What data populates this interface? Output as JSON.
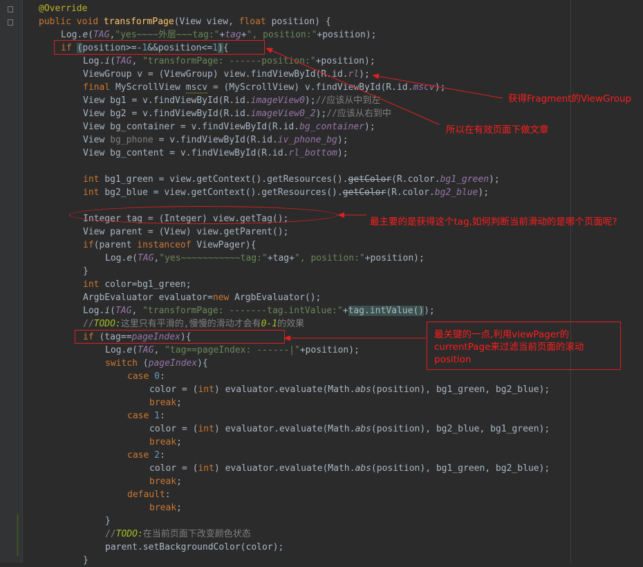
{
  "code_lines": [
    [
      [
        "@Override",
        "ann"
      ]
    ],
    [
      [
        "public void ",
        "kw"
      ],
      [
        "transformPage",
        "fn"
      ],
      [
        "(View view, "
      ],
      [
        "float ",
        "kw"
      ],
      [
        "position) {"
      ]
    ],
    [
      [
        "Log."
      ],
      [
        "e",
        "ital"
      ],
      [
        "("
      ],
      [
        "TAG",
        "fld"
      ],
      [
        ","
      ],
      [
        "\"yes~~~~外层~~~tag:\"",
        "str"
      ],
      [
        "+"
      ],
      [
        "tag",
        "fld"
      ],
      [
        "+"
      ],
      [
        "\", position:\"",
        "str"
      ],
      [
        "+position);"
      ]
    ],
    [
      [
        "if ",
        "kw"
      ],
      [
        "(",
        "hl"
      ],
      [
        "position>=-"
      ],
      [
        "1",
        "num"
      ],
      [
        "&&position<="
      ],
      [
        "1",
        "num"
      ],
      [
        ")",
        "hl"
      ],
      [
        "{"
      ]
    ],
    [
      [
        "Log."
      ],
      [
        "i",
        "ital"
      ],
      [
        "("
      ],
      [
        "TAG",
        "fld"
      ],
      [
        ", "
      ],
      [
        "\"transformPage: ------position:\"",
        "str"
      ],
      [
        "+position);"
      ]
    ],
    [
      [
        "ViewGroup v = (ViewGroup) view.findViewById(R.id."
      ],
      [
        "rl",
        "fld"
      ],
      [
        ");"
      ]
    ],
    [
      [
        "final ",
        "kw"
      ],
      [
        "MyScrollView "
      ],
      [
        "mscv",
        "warn"
      ],
      [
        " = (MyScrollView) v.findViewById(R.id."
      ],
      [
        "mscv",
        "fld"
      ],
      [
        ");"
      ]
    ],
    [
      [
        "View bg1 = v.findViewById(R.id."
      ],
      [
        "imageView0",
        "fld"
      ],
      [
        ");"
      ],
      [
        "//应该从中到左",
        "cmt"
      ]
    ],
    [
      [
        "View bg2 = v.findViewById(R.id."
      ],
      [
        "imageView0_2",
        "fld"
      ],
      [
        ");"
      ],
      [
        "//应该从右到中",
        "cmt"
      ]
    ],
    [
      [
        "View bg_container = v.findViewById(R.id."
      ],
      [
        "bg_container",
        "fld"
      ],
      [
        ");"
      ]
    ],
    [
      [
        "View "
      ],
      [
        "bg_phone",
        "cmt"
      ],
      [
        " = v.findViewById(R.id."
      ],
      [
        "iv_phone_bg",
        "fld"
      ],
      [
        ");"
      ]
    ],
    [
      [
        "View bg_content = v.findViewById(R.id."
      ],
      [
        "rl_bottom",
        "fld"
      ],
      [
        ");"
      ]
    ],
    [],
    [
      [
        "int ",
        "kw"
      ],
      [
        "bg1_green = view.getContext().getResources()."
      ],
      [
        "getColor",
        "strike"
      ],
      [
        "(R.color."
      ],
      [
        "bg1_green",
        "fld"
      ],
      [
        ");"
      ]
    ],
    [
      [
        "int ",
        "kw"
      ],
      [
        "bg2_blue = view.getContext().getResources()."
      ],
      [
        "getColor",
        "strike"
      ],
      [
        "(R.color."
      ],
      [
        "bg2_blue",
        "fld"
      ],
      [
        ");"
      ]
    ],
    [],
    [
      [
        "Integer tag = (Integer) view.getTag();"
      ]
    ],
    [
      [
        "View parent = (View) view.getParent();"
      ]
    ],
    [
      [
        "if",
        "kw"
      ],
      [
        "(parent "
      ],
      [
        "instanceof ",
        "kw"
      ],
      [
        "ViewPager){"
      ]
    ],
    [
      [
        "Log."
      ],
      [
        "e",
        "ital"
      ],
      [
        "("
      ],
      [
        "TAG",
        "fld"
      ],
      [
        ","
      ],
      [
        "\"yes~~~~~~~~~~~tag:\"",
        "str"
      ],
      [
        "+tag+"
      ],
      [
        "\", position:\"",
        "str"
      ],
      [
        "+position);"
      ]
    ],
    [
      [
        "}"
      ]
    ],
    [
      [
        "int ",
        "kw"
      ],
      [
        "color=bg1_green;"
      ]
    ],
    [
      [
        "ArgbEvaluator evaluator="
      ],
      [
        "new ",
        "kw"
      ],
      [
        "ArgbEvaluator();"
      ]
    ],
    [
      [
        "Log."
      ],
      [
        "i",
        "ital"
      ],
      [
        "("
      ],
      [
        "TAG",
        "fld"
      ],
      [
        ", "
      ],
      [
        "\"transformPage: -------tag.intValue:\"",
        "str"
      ],
      [
        "+"
      ],
      [
        "tag.intValue()",
        "hl"
      ],
      [
        ");"
      ]
    ],
    [
      [
        "//",
        "cmt"
      ],
      [
        "TODO:",
        "todo"
      ],
      [
        "这里只有平滑的,慢慢的滑动才会有",
        "cmt"
      ],
      [
        "0-1",
        "todo"
      ],
      [
        "的效果",
        "cmt"
      ]
    ],
    [
      [
        "if ",
        "kw"
      ],
      [
        "(tag=="
      ],
      [
        "pageIndex",
        "fld"
      ],
      [
        "){"
      ]
    ],
    [
      [
        "Log."
      ],
      [
        "e",
        "ital"
      ],
      [
        "("
      ],
      [
        "TAG",
        "fld"
      ],
      [
        ", "
      ],
      [
        "\"tag==pageIndex: ------|\"",
        "str"
      ],
      [
        "+position);"
      ]
    ],
    [
      [
        "switch ",
        "kw"
      ],
      [
        "("
      ],
      [
        "pageIndex",
        "fld"
      ],
      [
        "){"
      ]
    ],
    [
      [
        "case ",
        "kw"
      ],
      [
        "0",
        "num"
      ],
      [
        ":"
      ]
    ],
    [
      [
        "color = ("
      ],
      [
        "int",
        "kw"
      ],
      [
        ") evaluator.evaluate(Math."
      ],
      [
        "abs",
        "ital"
      ],
      [
        "(position), bg1_green, bg2_blue);"
      ]
    ],
    [
      [
        "break",
        "kw"
      ],
      [
        ";"
      ]
    ],
    [
      [
        "case ",
        "kw"
      ],
      [
        "1",
        "num"
      ],
      [
        ":"
      ]
    ],
    [
      [
        "color = ("
      ],
      [
        "int",
        "kw"
      ],
      [
        ") evaluator.evaluate(Math."
      ],
      [
        "abs",
        "ital"
      ],
      [
        "(position), bg2_blue, bg1_green);"
      ]
    ],
    [
      [
        "break",
        "kw"
      ],
      [
        ";"
      ]
    ],
    [
      [
        "case ",
        "kw"
      ],
      [
        "2",
        "num"
      ],
      [
        ":"
      ]
    ],
    [
      [
        "color = ("
      ],
      [
        "int",
        "kw"
      ],
      [
        ") evaluator.evaluate(Math."
      ],
      [
        "abs",
        "ital"
      ],
      [
        "(position), bg1_green, bg2_blue);"
      ]
    ],
    [
      [
        "break",
        "kw"
      ],
      [
        ";"
      ]
    ],
    [
      [
        "default",
        "kw"
      ],
      [
        ":"
      ]
    ],
    [
      [
        "break",
        "kw"
      ],
      [
        ";"
      ]
    ],
    [
      [
        "}"
      ]
    ],
    [
      [
        "//",
        "cmt"
      ],
      [
        "TODO:",
        "todo"
      ],
      [
        "在当前页面下改变颜色状态",
        "cmt"
      ]
    ],
    [
      [
        "parent.setBackgroundColor(color);"
      ]
    ],
    [
      [
        "}"
      ]
    ]
  ],
  "annotations": {
    "note_viewgroup": "获得Fragment的ViewGroup",
    "note_effective_page": "所以在有效页面下做文章",
    "note_get_tag": "最主要的是获得这个tag,如何判断当前滑动的是哪个页面呢?",
    "note_key_point": "最关键的一点,利用viewPager的currentPage来过滤当前页面的滚动position"
  },
  "colors": {
    "background": "#2b2b2b",
    "keyword": "#cc7832",
    "string": "#6a8759",
    "field": "#9876aa",
    "annotation_red": "#ff1e1e"
  }
}
